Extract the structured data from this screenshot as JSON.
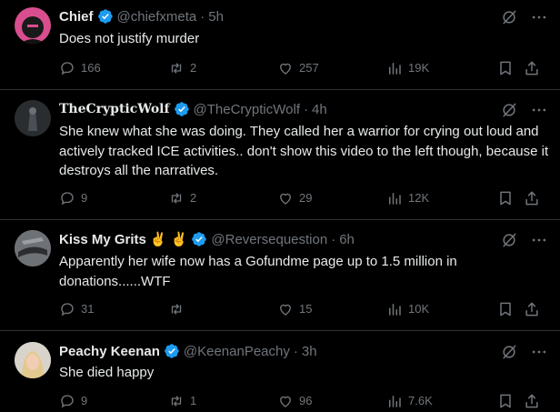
{
  "tweets": [
    {
      "name": "Chief",
      "handle": "@chiefxmeta",
      "time": "5h",
      "text": "Does not justify murder",
      "replies": "166",
      "reposts": "2",
      "likes": "257",
      "views": "19K"
    },
    {
      "name": "TheCrypticWolf",
      "handle": "@TheCrypticWolf",
      "time": "4h",
      "text": "She knew what she was doing. They called her a warrior for crying out loud and actively tracked ICE activities.. don't show this video to the left though, because it destroys all the narratives.",
      "replies": "9",
      "reposts": "2",
      "likes": "29",
      "views": "12K"
    },
    {
      "name": "Kiss My Grits",
      "name_emoji": "✌️ ✌️",
      "handle": "@Reversequestion",
      "time": "6h",
      "text": "Apparently her wife now has a Gofundme page up to 1.5 million in donations......WTF",
      "replies": "31",
      "reposts": "",
      "likes": "15",
      "views": "10K"
    },
    {
      "name": "Peachy Keenan",
      "handle": "@KeenanPeachy",
      "time": "3h",
      "text": "She died happy",
      "replies": "9",
      "reposts": "1",
      "likes": "96",
      "views": "7.6K"
    }
  ],
  "separator": "·",
  "icons": {
    "verified": "verified-badge-icon",
    "grok": "grok-icon",
    "more": "more-options-icon",
    "reply": "reply-icon",
    "repost": "repost-icon",
    "like": "like-icon",
    "views": "views-icon",
    "bookmark": "bookmark-icon",
    "share": "share-icon"
  },
  "colors": {
    "verified": "#1d9bf0",
    "muted": "#71767b",
    "text": "#e7e9ea",
    "divider": "#2f3336"
  }
}
